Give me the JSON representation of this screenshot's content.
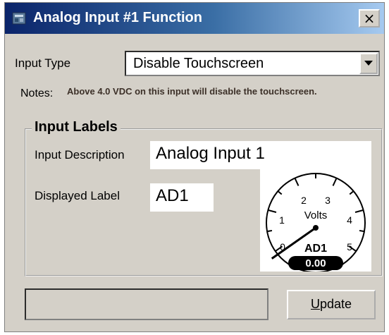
{
  "window": {
    "title": "Analog Input #1 Function",
    "close_glyph": "×"
  },
  "input_type": {
    "label": "Input Type",
    "selected": "Disable Touchscreen"
  },
  "notes": {
    "label": "Notes:",
    "text": "Above 4.0 VDC on this input will disable the touchscreen."
  },
  "input_labels": {
    "group_title": "Input Labels",
    "description_label": "Input Description",
    "description_value": "Analog Input 1",
    "displayed_label": "Displayed Label",
    "displayed_value": "AD1"
  },
  "gauge": {
    "unit": "Volts",
    "ticks": [
      "0",
      "1",
      "2",
      "3",
      "4",
      "5"
    ],
    "label": "AD1",
    "readout": "0.00",
    "needle_value": 0.0
  },
  "status_text": "",
  "update_button": {
    "mnemonic": "U",
    "rest": "pdate"
  },
  "icons": {
    "app": "app-icon",
    "close": "close-icon",
    "dropdown": "dropdown-arrow-icon"
  }
}
